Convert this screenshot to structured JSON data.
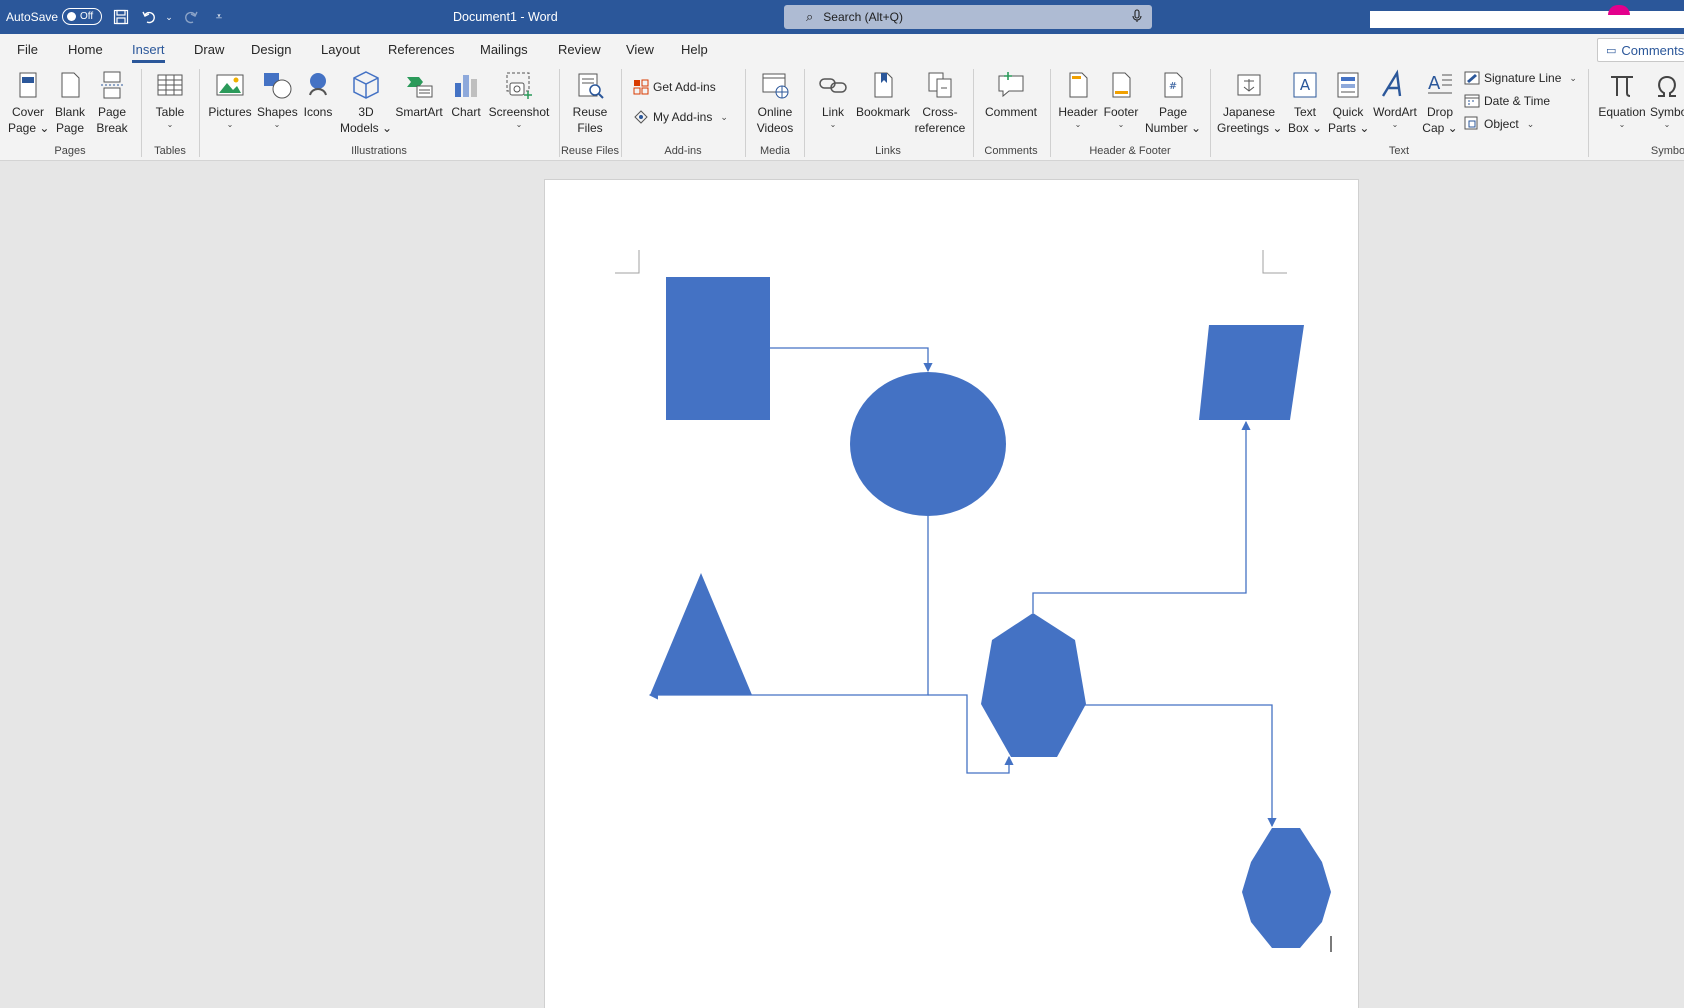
{
  "titlebar": {
    "autosave_label": "AutoSave",
    "autosave_state": "Off",
    "doc_title": "Document1  -  Word",
    "search_placeholder": "Search (Alt+Q)"
  },
  "tabs": [
    {
      "label": "File"
    },
    {
      "label": "Home"
    },
    {
      "label": "Insert",
      "active": true
    },
    {
      "label": "Draw"
    },
    {
      "label": "Design"
    },
    {
      "label": "Layout"
    },
    {
      "label": "References"
    },
    {
      "label": "Mailings"
    },
    {
      "label": "Review"
    },
    {
      "label": "View"
    },
    {
      "label": "Help"
    }
  ],
  "comments_label": "Comments",
  "ribbon": {
    "pages": {
      "group": "Pages",
      "cover_page": [
        "Cover",
        "Page"
      ],
      "blank_page": [
        "Blank",
        "Page"
      ],
      "page_break": [
        "Page",
        "Break"
      ]
    },
    "tables": {
      "group": "Tables",
      "table": "Table"
    },
    "illustrations": {
      "group": "Illustrations",
      "pictures": "Pictures",
      "shapes": "Shapes",
      "icons": "Icons",
      "models": [
        "3D",
        "Models"
      ],
      "smartart": "SmartArt",
      "chart": "Chart",
      "screenshot": "Screenshot"
    },
    "reuse": {
      "group": "Reuse Files",
      "reuse_files": [
        "Reuse",
        "Files"
      ]
    },
    "addins": {
      "group": "Add-ins",
      "get_addins": "Get Add-ins",
      "my_addins": "My Add-ins"
    },
    "media": {
      "group": "Media",
      "online_videos": [
        "Online",
        "Videos"
      ]
    },
    "links": {
      "group": "Links",
      "link": "Link",
      "bookmark": "Bookmark",
      "cross_reference": [
        "Cross-",
        "reference"
      ]
    },
    "comments": {
      "group": "Comments",
      "comment": "Comment"
    },
    "header_footer": {
      "group": "Header & Footer",
      "header": "Header",
      "footer": "Footer",
      "page_number": [
        "Page",
        "Number"
      ]
    },
    "text": {
      "group": "Text",
      "japanese_greetings": [
        "Japanese",
        "Greetings"
      ],
      "text_box": [
        "Text",
        "Box"
      ],
      "quick_parts": [
        "Quick",
        "Parts"
      ],
      "wordart": "WordArt",
      "drop_cap": [
        "Drop",
        "Cap"
      ],
      "signature_line": "Signature Line",
      "date_time": "Date & Time",
      "object": "Object"
    },
    "symbols": {
      "group": "Symbo",
      "equation": "Equation",
      "symbol": "Symbo"
    }
  },
  "colors": {
    "title_bar": "#2b579a",
    "shape_fill": "#4472c4",
    "connector": "#4472c4",
    "ribbon_bg": "#f3f3f3",
    "canvas_bg": "#e6e6e6"
  }
}
